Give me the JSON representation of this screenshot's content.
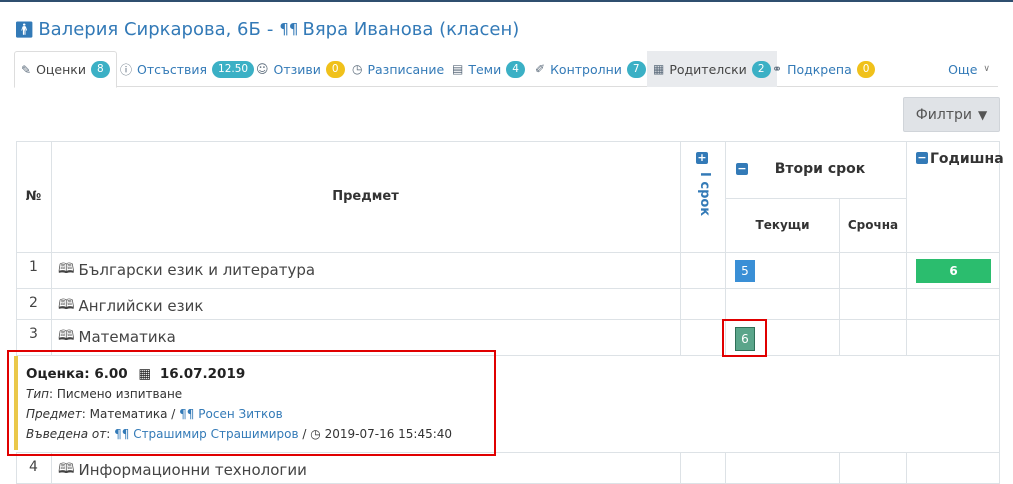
{
  "header": {
    "student": "Валерия Сиркарова, 6Б",
    "separator": "-",
    "parent": "Вяра Иванова (класен)"
  },
  "tabs": [
    {
      "label": "Оценки",
      "count": "8",
      "icon": "pencil-icon"
    },
    {
      "label": "Отсъствия",
      "count": "12.50",
      "icon": "info-circle-icon"
    },
    {
      "label": "Отзиви",
      "count": "0",
      "icon": "users-icon"
    },
    {
      "label": "Разписание",
      "icon": "clock-icon"
    },
    {
      "label": "Теми",
      "count": "4",
      "icon": "list-icon"
    },
    {
      "label": "Контролни",
      "count": "7",
      "icon": "edit-icon"
    },
    {
      "label": "Родителски",
      "count": "2",
      "icon": "calendar-icon"
    },
    {
      "label": "Подкрепа",
      "count": "0",
      "icon": "handshake-icon"
    }
  ],
  "more_label": "Още",
  "filter_label": "Филтри",
  "table": {
    "col_num": "№",
    "col_subject": "Предмет",
    "term1": "I срок",
    "term2": "Втори срок",
    "annual": "Годишна",
    "current": "Текущи",
    "final": "Срочна",
    "rows": [
      {
        "num": "1",
        "subject": "Български език и литература",
        "current_grade": "5",
        "annual_grade": "6"
      },
      {
        "num": "2",
        "subject": "Английски език"
      },
      {
        "num": "3",
        "subject": "Математика",
        "current_grade": "6"
      },
      {
        "num": "4",
        "subject": "Информационни технологии"
      }
    ]
  },
  "detail": {
    "grade_label": "Оценка: 6.00",
    "date": "16.07.2019",
    "type_label": "Тип",
    "type_value": ": Писмено изпитване",
    "subject_label": "Предмет",
    "subject_value": ": Математика /",
    "teacher": "Росен Зитков",
    "entered_label": "Въведена от",
    "entered_sep": ":",
    "entered_by": "Страшимир Страшимиров",
    "slash": "/",
    "timestamp": "2019-07-16 15:45:40"
  },
  "colors": {
    "link": "#337ab7",
    "badge_teal": "#3bb0c5",
    "badge_yellow": "#f0c11b",
    "grade_5": "#3a8fd6",
    "grade_6_annual": "#2bbd6e",
    "grade_6_current": "#5aa58a",
    "highlight": "#e00000"
  }
}
